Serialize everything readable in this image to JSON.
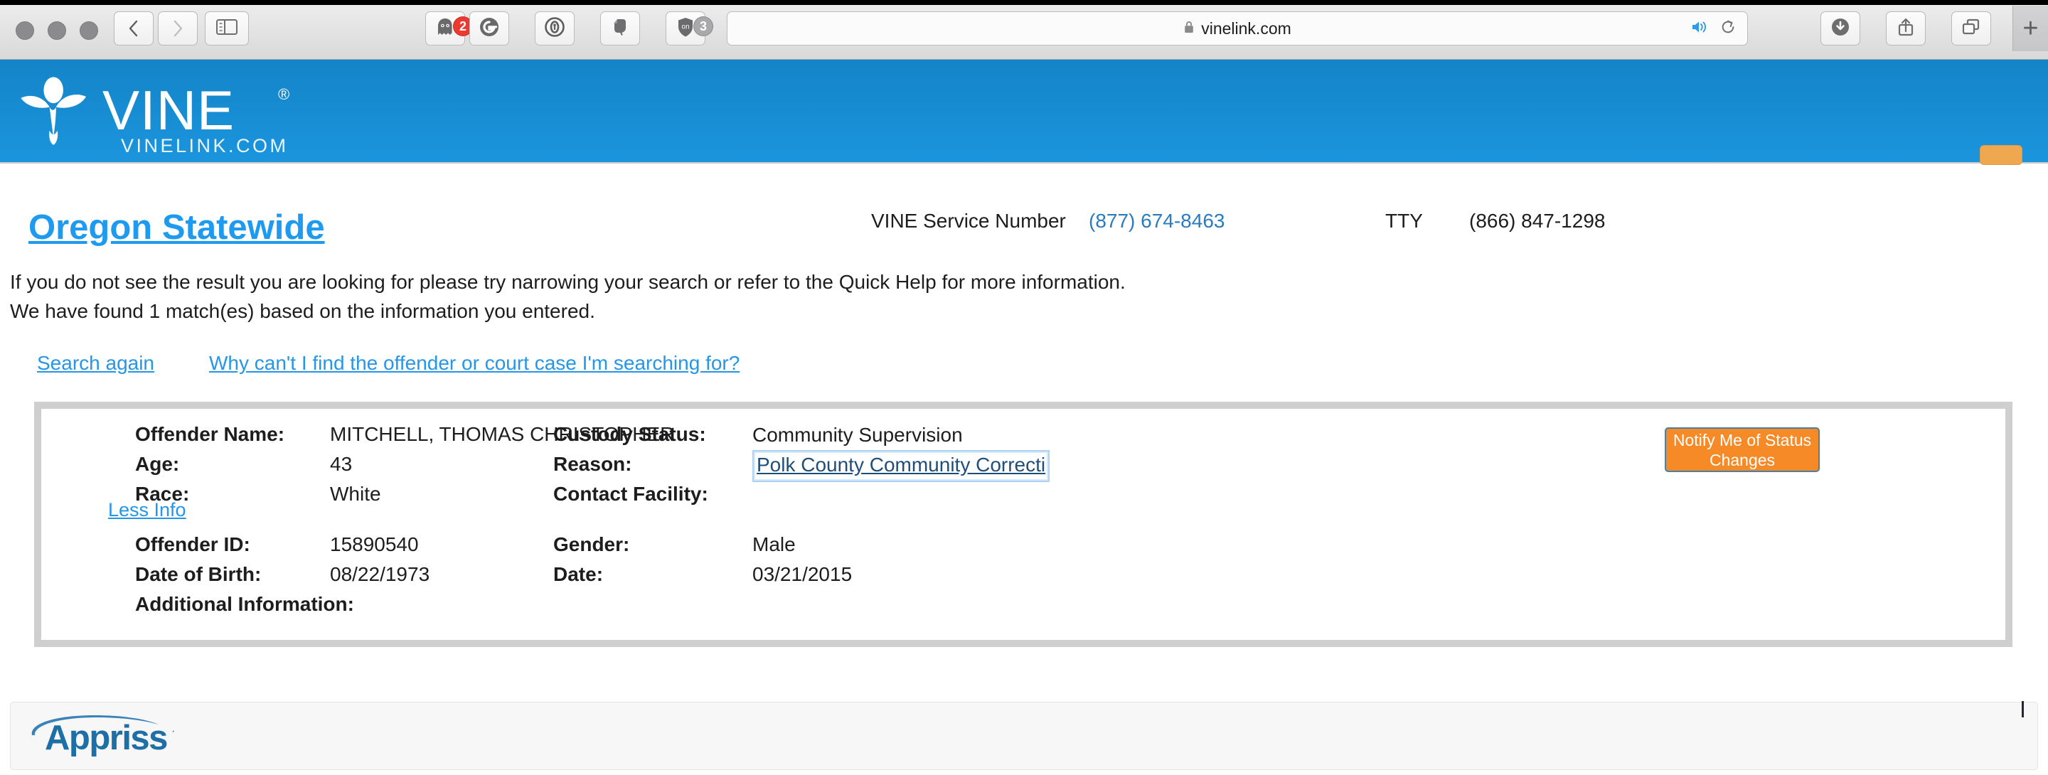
{
  "browser": {
    "url": "vinelink.com",
    "lock_icon": "lock-icon",
    "audio_icon": "speaker-playing-icon",
    "reload_icon": "reload-icon",
    "back_icon": "chevron-left-icon",
    "forward_icon": "chevron-right-icon",
    "sidebar_icon": "sidebar-toggle-icon",
    "downloads_icon": "download-icon",
    "share_icon": "share-icon",
    "tabs_icon": "tab-overview-icon",
    "newtab_label": "+",
    "extensions": [
      {
        "name": "ghostery-extension-icon",
        "badge": "2",
        "badge_color": "#ec3a30"
      },
      {
        "name": "grammarly-extension-icon",
        "badge": "",
        "badge_color": ""
      },
      {
        "name": "1password-extension-icon",
        "badge": "",
        "badge_color": ""
      },
      {
        "name": "evernote-extension-icon",
        "badge": "",
        "badge_color": ""
      },
      {
        "name": "ublock-origin-extension-icon",
        "badge": "3",
        "badge_color": "#a9a9ab"
      }
    ]
  },
  "site_header": {
    "brand": "VINE",
    "registered_mark": "®",
    "subtitle": "VINELINK.COM",
    "brand_bg_color": "#1484c8",
    "accent_orange": "#efa850"
  },
  "page": {
    "state_link": "Oregon Statewide",
    "service_number_label": "VINE Service Number",
    "service_number": "(877) 674-8463",
    "tty_label": "TTY",
    "tty_number": "(866) 847-1298",
    "notice_line_1": "If you do not see the result you are looking for please try narrowing your search or refer to the Quick Help for more information.",
    "notice_line_2": "We have found 1 match(es) based on the information you entered.",
    "search_again_link": "Search again",
    "why_link": "Why can't I find the offender or court case I'm searching for?",
    "link_color": "#2596e8"
  },
  "result": {
    "left_column": [
      {
        "label": "Offender Name:",
        "value": "MITCHELL, THOMAS CHRISTOPHER"
      },
      {
        "label": "Age:",
        "value": "43"
      },
      {
        "label": "Race:",
        "value": "White"
      }
    ],
    "right_column": [
      {
        "label": "Custody Status:",
        "value": "Community Supervision"
      },
      {
        "label": "Reason:",
        "value": "Community Supervision"
      },
      {
        "label": "Contact Facility:",
        "value": "Polk County Community Correcti"
      }
    ],
    "toggle_link": "Less Info",
    "expanded_left": [
      {
        "label": "Offender ID:",
        "value": "15890540"
      },
      {
        "label": "Date of Birth:",
        "value": "08/22/1973"
      },
      {
        "label": "Additional Information:",
        "value": ""
      }
    ],
    "expanded_right": [
      {
        "label": "Gender:",
        "value": "Male"
      },
      {
        "label": "Date:",
        "value": "03/21/2015"
      }
    ],
    "notify_button": "Notify Me of Status Changes",
    "notify_button_color": "#f68a27",
    "facility_link_color": "#1f4e79"
  },
  "footer": {
    "company": "Appriss",
    "registered_mark": "·",
    "logo_color": "#1d6fa5"
  }
}
